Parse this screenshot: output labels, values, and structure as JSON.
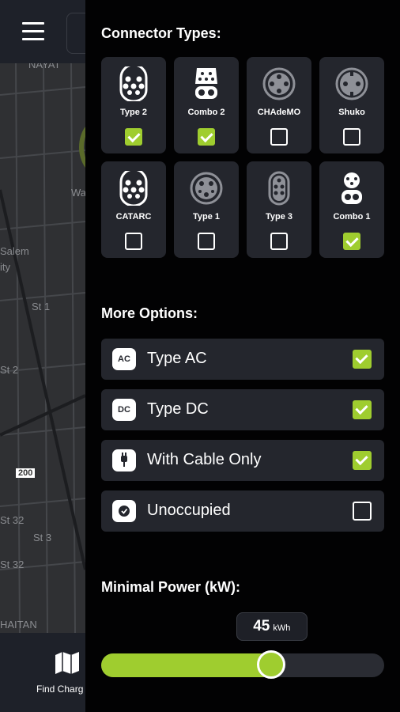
{
  "background": {
    "find_label": "Find Charg",
    "map_labels": [
      "NAYAT",
      "Wa",
      "Salem",
      "ity",
      "St 1",
      "St 2",
      "200",
      "St 32",
      "St 32",
      "St 3",
      "HAITAN"
    ]
  },
  "connectors": {
    "title": "Connector Types:",
    "items": [
      {
        "label": "Type 2",
        "icon": "type2-connector-icon",
        "checked": true
      },
      {
        "label": "Combo 2",
        "icon": "combo2-connector-icon",
        "checked": true
      },
      {
        "label": "CHAdeMO",
        "icon": "chademo-connector-icon",
        "checked": false
      },
      {
        "label": "Shuko",
        "icon": "shuko-connector-icon",
        "checked": false
      },
      {
        "label": "CATARC",
        "icon": "catarc-connector-icon",
        "checked": false
      },
      {
        "label": "Type 1",
        "icon": "type1-connector-icon",
        "checked": false
      },
      {
        "label": "Type 3",
        "icon": "type3-connector-icon",
        "checked": false
      },
      {
        "label": "Combo 1",
        "icon": "combo1-connector-icon",
        "checked": true
      }
    ]
  },
  "options": {
    "title": "More Options:",
    "items": [
      {
        "label": "Type AC",
        "badge": "AC",
        "checked": true
      },
      {
        "label": "Type DC",
        "badge": "DC",
        "checked": true
      },
      {
        "label": "With Cable Only",
        "badge": "plug-icon",
        "checked": true
      },
      {
        "label": "Unoccupied",
        "badge": "check-circle-icon",
        "checked": false
      }
    ]
  },
  "power": {
    "title": "Minimal Power (kW):",
    "value": "45",
    "unit": "kWh",
    "fraction": 0.6,
    "accent": "#9fcd2f"
  }
}
